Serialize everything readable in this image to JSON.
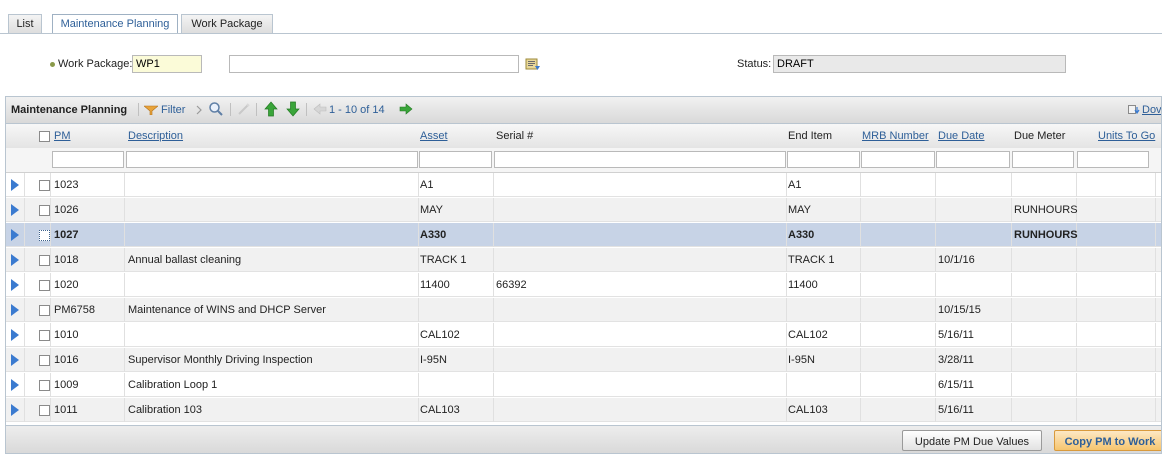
{
  "tabs": [
    {
      "label": "List"
    },
    {
      "label": "Maintenance Planning"
    },
    {
      "label": "Work Package"
    }
  ],
  "header": {
    "work_package_label": "Work Package:",
    "work_package_value": "WP1",
    "description_value": "",
    "status_label": "Status:",
    "status_value": "DRAFT"
  },
  "toolbar": {
    "title": "Maintenance Planning",
    "filter_label": "Filter",
    "pagination": "1 - 10 of 14",
    "download_label": "Dov"
  },
  "columns": {
    "pm": "PM",
    "description": "Description",
    "asset": "Asset",
    "serial": "Serial #",
    "end_item": "End Item",
    "mrb": "MRB Number",
    "due_date": "Due Date",
    "due_meter": "Due Meter",
    "units_to_go": "Units To Go"
  },
  "rows": [
    {
      "pm": "1023",
      "description": "",
      "asset": "A1",
      "serial": "",
      "end_item": "A1",
      "mrb": "",
      "due_date": "",
      "due_meter": "",
      "units": ""
    },
    {
      "pm": "1026",
      "description": "",
      "asset": "MAY",
      "serial": "",
      "end_item": "MAY",
      "mrb": "",
      "due_date": "",
      "due_meter": "RUNHOURS",
      "units": ""
    },
    {
      "pm": "1027",
      "description": "",
      "asset": "A330",
      "serial": "",
      "end_item": "A330",
      "mrb": "",
      "due_date": "",
      "due_meter": "RUNHOURS",
      "units": ""
    },
    {
      "pm": "1018",
      "description": "Annual ballast cleaning",
      "asset": "TRACK 1",
      "serial": "",
      "end_item": "TRACK 1",
      "mrb": "",
      "due_date": "10/1/16",
      "due_meter": "",
      "units": ""
    },
    {
      "pm": "1020",
      "description": "",
      "asset": "11400",
      "serial": "66392",
      "end_item": "11400",
      "mrb": "",
      "due_date": "",
      "due_meter": "",
      "units": ""
    },
    {
      "pm": "PM6758",
      "description": "Maintenance of WINS and DHCP Server",
      "asset": "",
      "serial": "",
      "end_item": "",
      "mrb": "",
      "due_date": "10/15/15",
      "due_meter": "",
      "units": ""
    },
    {
      "pm": "1010",
      "description": "",
      "asset": "CAL102",
      "serial": "",
      "end_item": "CAL102",
      "mrb": "",
      "due_date": "5/16/11",
      "due_meter": "",
      "units": ""
    },
    {
      "pm": "1016",
      "description": "Supervisor Monthly Driving Inspection",
      "asset": "I-95N",
      "serial": "",
      "end_item": "I-95N",
      "mrb": "",
      "due_date": "3/28/11",
      "due_meter": "",
      "units": ""
    },
    {
      "pm": "1009",
      "description": "Calibration Loop 1",
      "asset": "",
      "serial": "",
      "end_item": "",
      "mrb": "",
      "due_date": "6/15/11",
      "due_meter": "",
      "units": ""
    },
    {
      "pm": "1011",
      "description": "Calibration 103",
      "asset": "CAL103",
      "serial": "",
      "end_item": "CAL103",
      "mrb": "",
      "due_date": "5/16/11",
      "due_meter": "",
      "units": ""
    }
  ],
  "selected_row_index": 2,
  "footer": {
    "update_button": "Update PM Due Values",
    "copy_button": "Copy PM to Work"
  },
  "colors": {
    "accent": "#2e5f98",
    "selected_row": "#c7d3e6",
    "arrow": "#3b7bd0",
    "primary_button": "#f6c56f"
  }
}
